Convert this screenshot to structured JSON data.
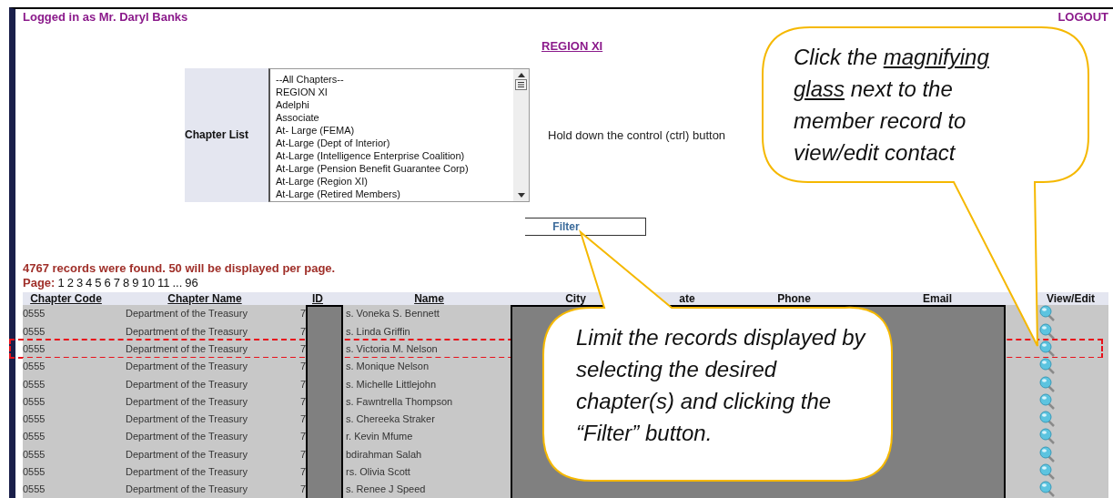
{
  "header": {
    "user_label": "Logged in as Mr. Daryl Banks",
    "logout": "LOGOUT"
  },
  "region_link": "REGION XI",
  "chapter_filter": {
    "label": "Chapter List",
    "options": [
      "--All Chapters--",
      "REGION XI",
      "Adelphi",
      "Associate",
      "At- Large (FEMA)",
      "At-Large (Dept of Interior)",
      "At-Large (Intelligence Enterprise Coalition)",
      "At-Large (Pension Benefit Guarantee Corp)",
      "At-Large (Region XI)",
      "At-Large (Retired Members)"
    ],
    "hint": "Hold down the control (ctrl) button",
    "filter_button": "Filter"
  },
  "results": {
    "summary": "4767 records were found. 50 will be displayed per page.",
    "page_label": "Page:",
    "pages": [
      "1",
      "2",
      "3",
      "4",
      "5",
      "6",
      "7",
      "8",
      "9",
      "10",
      "11",
      "...",
      "96"
    ]
  },
  "table": {
    "columns": [
      "Chapter Code",
      "Chapter Name",
      "ID",
      "Name",
      "City",
      "ate",
      "Phone",
      "Email",
      "View/Edit"
    ],
    "rows": [
      {
        "chapter_code": "0555",
        "chapter_name": "Department of the Treasury",
        "id": "7",
        "name": "s. Voneka S. Bennett",
        "highlighted": false
      },
      {
        "chapter_code": "0555",
        "chapter_name": "Department of the Treasury",
        "id": "7",
        "name": "s. Linda Griffin",
        "highlighted": false
      },
      {
        "chapter_code": "0555",
        "chapter_name": "Department of the Treasury",
        "id": "7",
        "name": "s. Victoria M. Nelson",
        "highlighted": true
      },
      {
        "chapter_code": "0555",
        "chapter_name": "Department of the Treasury",
        "id": "7",
        "name": "s. Monique Nelson",
        "highlighted": false
      },
      {
        "chapter_code": "0555",
        "chapter_name": "Department of the Treasury",
        "id": "7",
        "name": "s. Michelle Littlejohn",
        "highlighted": false
      },
      {
        "chapter_code": "0555",
        "chapter_name": "Department of the Treasury",
        "id": "7",
        "name": "s. Fawntrella Thompson",
        "highlighted": false
      },
      {
        "chapter_code": "0555",
        "chapter_name": "Department of the Treasury",
        "id": "7",
        "name": "s. Chereeka Straker",
        "highlighted": false
      },
      {
        "chapter_code": "0555",
        "chapter_name": "Department of the Treasury",
        "id": "7",
        "name": "r. Kevin Mfume",
        "highlighted": false
      },
      {
        "chapter_code": "0555",
        "chapter_name": "Department of the Treasury",
        "id": "7",
        "name": "bdirahman Salah",
        "highlighted": false
      },
      {
        "chapter_code": "0555",
        "chapter_name": "Department of the Treasury",
        "id": "7",
        "name": "rs. Olivia Scott",
        "highlighted": false
      },
      {
        "chapter_code": "0555",
        "chapter_name": "Department of the Treasury",
        "id": "7",
        "name": "s. Renee J Speed",
        "highlighted": false
      }
    ]
  },
  "callouts": [
    {
      "before": "Click the ",
      "underlined": "magnifying glass",
      "after": " next to the member record to view/edit contact"
    },
    {
      "before": "Limit the records displayed by selecting the desired chapter(s) and clicking the “Filter” button."
    }
  ]
}
